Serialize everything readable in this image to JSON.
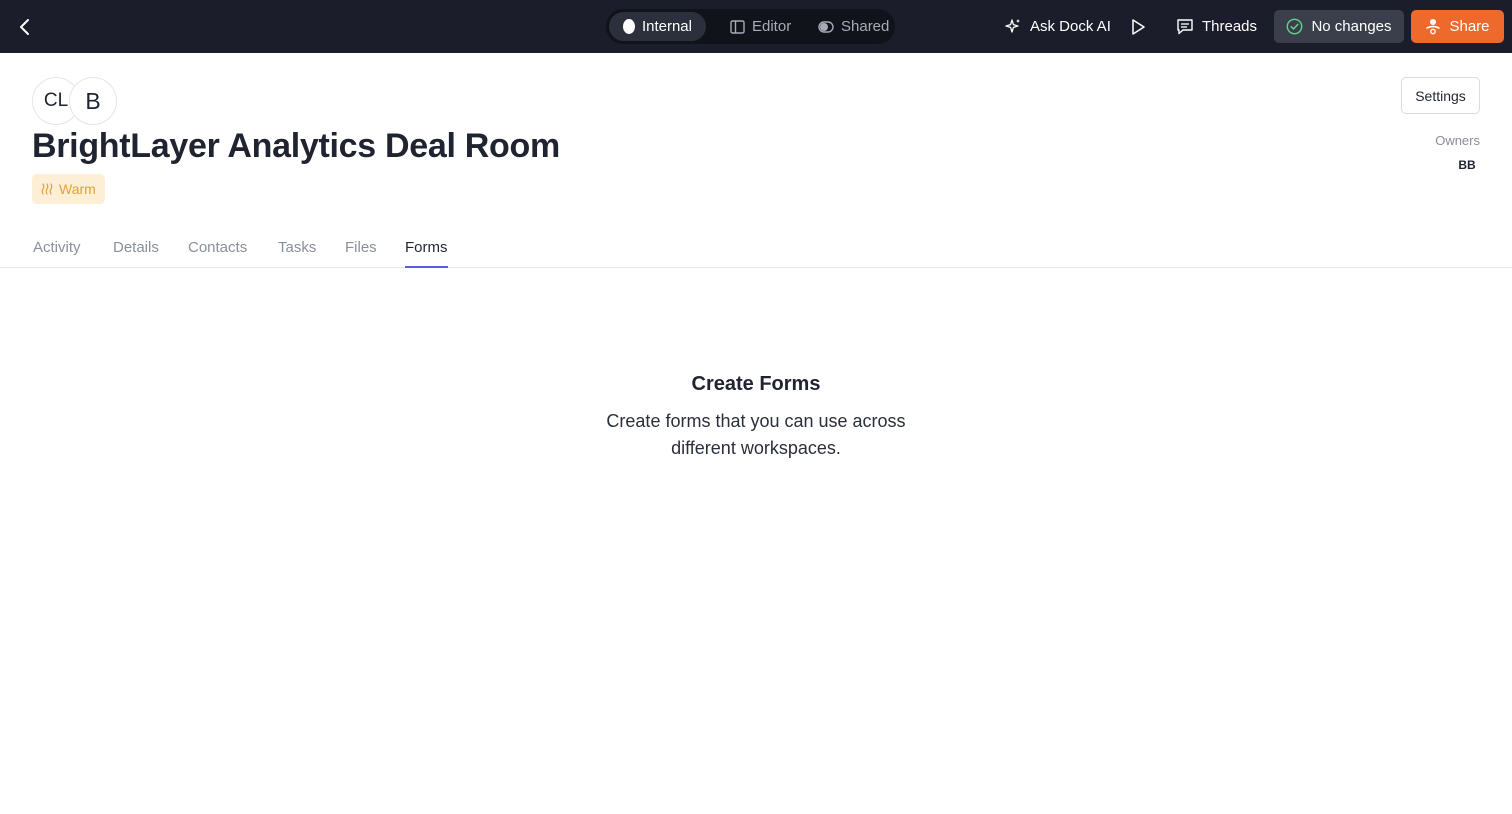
{
  "topbar": {
    "modes": [
      {
        "label": "Internal",
        "active": true,
        "icon": "circle-icon"
      },
      {
        "label": "Editor",
        "active": false,
        "icon": "sidebar-panel-icon"
      },
      {
        "label": "Shared",
        "active": false,
        "icon": "toggle-icon"
      }
    ],
    "ask_ai_label": "Ask Dock AI",
    "threads_label": "Threads",
    "no_changes_label": "No changes",
    "share_label": "Share",
    "colors": {
      "bar": "#1b1e2a",
      "share": "#ee6a2c",
      "no_changes": "#3b3f4b"
    }
  },
  "header": {
    "avatars": [
      "CL",
      "B"
    ],
    "title": "BrightLayer Analytics Deal Room",
    "status": {
      "label": "Warm",
      "icon": "heat-icon",
      "color": "#e2a23a"
    },
    "settings_label": "Settings",
    "owners_label": "Owners",
    "owners": [
      "BB"
    ]
  },
  "tabs": [
    {
      "label": "Activity",
      "active": false
    },
    {
      "label": "Details",
      "active": false
    },
    {
      "label": "Contacts",
      "active": false
    },
    {
      "label": "Tasks",
      "active": false
    },
    {
      "label": "Files",
      "active": false
    },
    {
      "label": "Forms",
      "active": true
    }
  ],
  "empty_state": {
    "title": "Create Forms",
    "description": "Create forms that you can use across different workspaces."
  }
}
